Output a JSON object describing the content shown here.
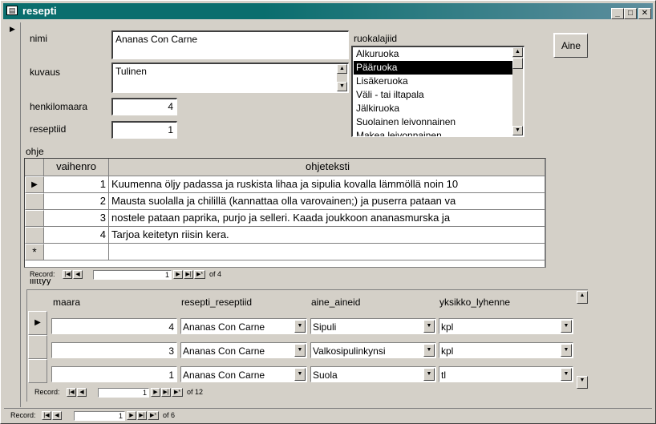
{
  "window": {
    "title": "resepti",
    "icon": "form-icon",
    "buttons": {
      "minimize": "_",
      "maximize": "□",
      "close": "✕"
    }
  },
  "form": {
    "nimi_label": "nimi",
    "nimi_value": "Ananas Con Carne",
    "kuvaus_label": "kuvaus",
    "kuvaus_value": "Tulinen",
    "henkilomaara_label": "henkilomaara",
    "henkilomaara_value": "4",
    "reseptiid_label": "reseptiid",
    "reseptiid_value": "1",
    "ruokalajiid_label": "ruokalajiid",
    "ruokalajiid_items": [
      "Alkuruoka",
      "Pääruoka",
      "Lisäkeruoka",
      "Väli - tai iltapala",
      "Jälkiruoka",
      "Suolainen leivonnainen",
      "Makea leivonnainen"
    ],
    "ruokalajiid_selected_index": 1,
    "aine_button": "Aine",
    "ohje_label": "ohje",
    "liittyy_label": "liittyy"
  },
  "ohje": {
    "headers": [
      "vaihenro",
      "ohjeteksti"
    ],
    "rows": [
      {
        "vaihenro": "1",
        "ohjeteksti": "Kuumenna öljy padassa ja ruskista lihaa ja sipulia kovalla lämmöllä noin 10"
      },
      {
        "vaihenro": "2",
        "ohjeteksti": "Mausta suolalla ja chilillä (kannattaa olla varovainen;) ja puserra pataan va"
      },
      {
        "vaihenro": "3",
        "ohjeteksti": "nostele pataan paprika, purjo ja selleri. Kaada joukkoon ananasmurska ja"
      },
      {
        "vaihenro": "4",
        "ohjeteksti": "Tarjoa keitetyn riisin kera."
      }
    ],
    "new_row_marker": "*",
    "nav": {
      "label": "Record:",
      "current": "1",
      "of": "of  4"
    }
  },
  "liittyy": {
    "headers": [
      "maara",
      "resepti_reseptiid",
      "aine_aineid",
      "yksikko_lyhenne"
    ],
    "rows": [
      {
        "maara": "4",
        "resepti": "Ananas Con Carne",
        "aine": "Sipuli",
        "yksikko": "kpl"
      },
      {
        "maara": "3",
        "resepti": "Ananas Con Carne",
        "aine": "Valkosipulinkynsi",
        "yksikko": "kpl"
      },
      {
        "maara": "1",
        "resepti": "Ananas Con Carne",
        "aine": "Suola",
        "yksikko": "tl"
      }
    ],
    "nav": {
      "label": "Record:",
      "current": "1",
      "of": "of  12"
    }
  },
  "main_nav": {
    "label": "Record:",
    "current": "1",
    "of": "of  6"
  }
}
